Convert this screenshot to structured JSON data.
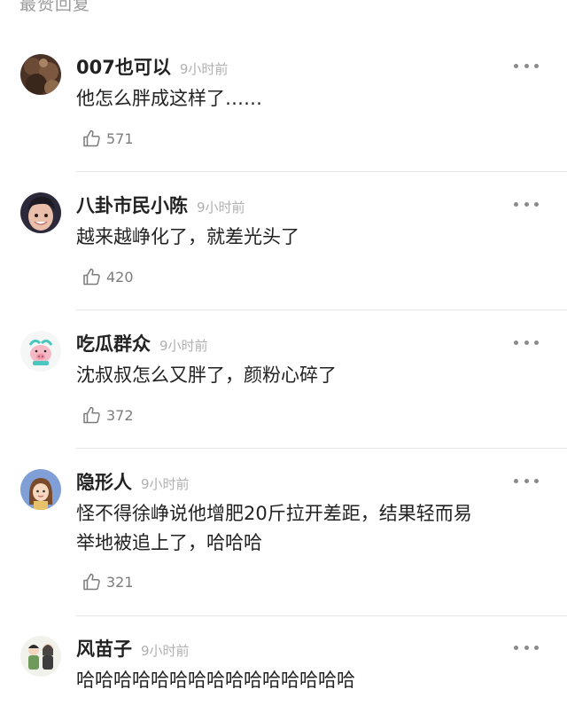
{
  "section_title": "最赞回复",
  "comments": [
    {
      "username": "007也可以",
      "time": "9小时前",
      "text": "他怎么胖成这样了……",
      "likes": "571",
      "avatar": "avatar-brown-photo"
    },
    {
      "username": "八卦市民小陈",
      "time": "9小时前",
      "text": "越来越峥化了，就差光头了",
      "likes": "420",
      "avatar": "avatar-smiling-face-photo"
    },
    {
      "username": "吃瓜群众",
      "time": "9小时前",
      "text": "沈叔叔怎么又胖了，颜粉心碎了",
      "likes": "372",
      "avatar": "avatar-cartoon-pig"
    },
    {
      "username": "隐形人",
      "time": "9小时前",
      "text": "怪不得徐峥说他增肥20斤拉开差距，结果轻而易\n举地被追上了，哈哈哈",
      "likes": "321",
      "avatar": "avatar-cartoon-girl"
    },
    {
      "username": "风苗子",
      "time": "9小时前",
      "text": "哈哈哈哈哈哈哈哈哈哈哈哈哈哈哈",
      "likes": "",
      "avatar": "avatar-cartoon-couple"
    }
  ],
  "icons": {
    "like": "thumbs-up-icon",
    "more": "more-dots-icon"
  },
  "colors": {
    "text": "#222222",
    "secondary": "#b0b0b0",
    "divider": "#e6e6e6"
  }
}
